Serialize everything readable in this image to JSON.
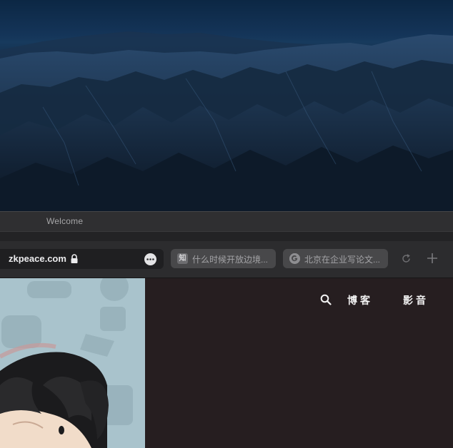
{
  "window": {
    "title": "Welcome"
  },
  "address_bar": {
    "url": "zkpeace.com"
  },
  "favorites": [
    {
      "badge": "知",
      "label": "什么时候开放边境..."
    },
    {
      "badge": "",
      "label": "北京在企业写论文..."
    }
  ],
  "site_nav": {
    "items": [
      {
        "label": "博客"
      },
      {
        "label": "影音"
      }
    ]
  },
  "colors": {
    "content_bg": "#261e20",
    "hero_bg": "#a9c3cc",
    "toolbar_bg": "#2c2c2e",
    "wallpaper_sky": "#143458"
  },
  "icons": [
    "lock-icon",
    "more-icon",
    "google-icon",
    "reload-icon",
    "plus-icon",
    "search-icon"
  ]
}
